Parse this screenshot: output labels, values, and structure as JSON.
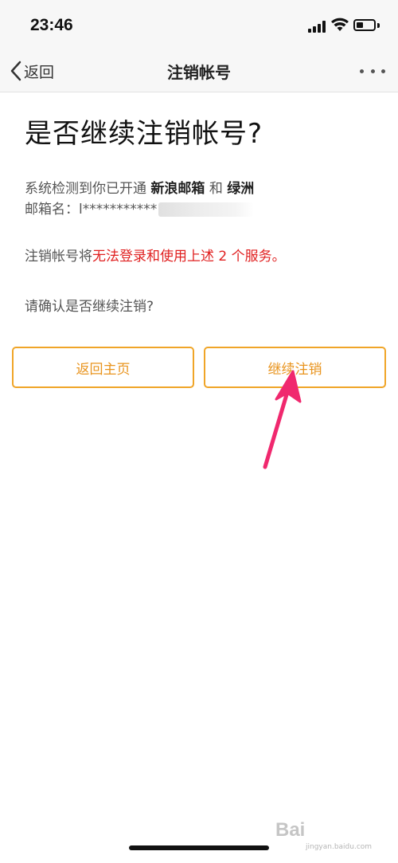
{
  "status_bar": {
    "time": "23:46"
  },
  "nav": {
    "back_label": "返回",
    "title": "注销帐号",
    "more_icon": "ellipsis-icon"
  },
  "content": {
    "heading": "是否继续注销帐号?",
    "detect_prefix": "系统检测到你已开通",
    "service_1": "新浪邮箱",
    "and_word": "和",
    "service_2": "绿洲",
    "email_label": "邮箱名：",
    "email_value": "l***********",
    "warn_prefix": "注销帐号将",
    "warn_red": "无法登录和使用上述 2 个服务。",
    "confirm": "请确认是否继续注销?"
  },
  "buttons": {
    "home": "返回主页",
    "continue": "继续注销"
  },
  "watermark": {
    "brand": "Bai",
    "sub": "jingyan.baidu.com"
  },
  "colors": {
    "accent": "#f0a528",
    "accent_text": "#e9941e",
    "warning": "#e02020",
    "annotation_arrow": "#f0286e"
  }
}
